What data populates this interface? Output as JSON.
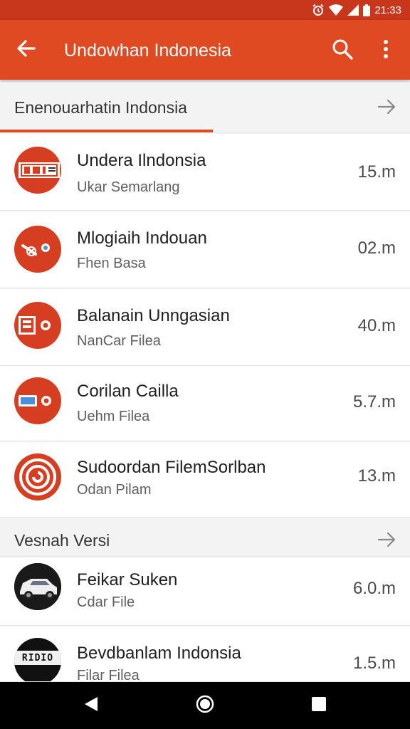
{
  "status_bar": {
    "time": "21:33"
  },
  "app_bar": {
    "title": "Undowhan Indonesia",
    "back_icon": "arrow-back-icon",
    "search_icon": "search-icon",
    "more_icon": "more-vert-icon"
  },
  "sections": [
    {
      "title": "Enenouarhatin Indonsia",
      "arrow_icon": "arrow-right-icon"
    },
    {
      "title": "Vesnah Versi",
      "arrow_icon": "arrow-right-icon"
    }
  ],
  "items": [
    {
      "title": "Undera Ilndonsia",
      "subtitle": "Ukar Semarlang",
      "size": "15.m",
      "icon": "tv-app-icon"
    },
    {
      "title": "Mlogiaih Indouan",
      "subtitle": "Fhen Basa",
      "size": "02.m",
      "icon": "tools-app-icon"
    },
    {
      "title": "Balanain Unngasian",
      "subtitle": "NanCar Filea",
      "size": "40.m",
      "icon": "printer-app-icon"
    },
    {
      "title": "Corilan Cailla",
      "subtitle": "Uehm Filea",
      "size": "5.7.m",
      "icon": "card-app-icon"
    },
    {
      "title": "Sudoordan FilemSorlban",
      "subtitle": "Odan Pilam",
      "size": "13.m",
      "icon": "swirl-app-icon"
    },
    {
      "title": "Feikar Suken",
      "subtitle": "Cdar File",
      "size": "6.0.m",
      "icon": "car-app-icon"
    },
    {
      "title": "Bevdbanlam Indonsia",
      "subtitle": "Filar Filea",
      "size": "1.5.m",
      "icon": "radio-app-icon",
      "badge": "RIDIO"
    }
  ],
  "colors": {
    "accent": "#df4a23",
    "status_bar": "#c8361b",
    "icon_red": "#d63e22"
  },
  "nav": {
    "back_icon": "nav-back-icon",
    "home_icon": "nav-home-icon",
    "recents_icon": "nav-recents-icon"
  }
}
